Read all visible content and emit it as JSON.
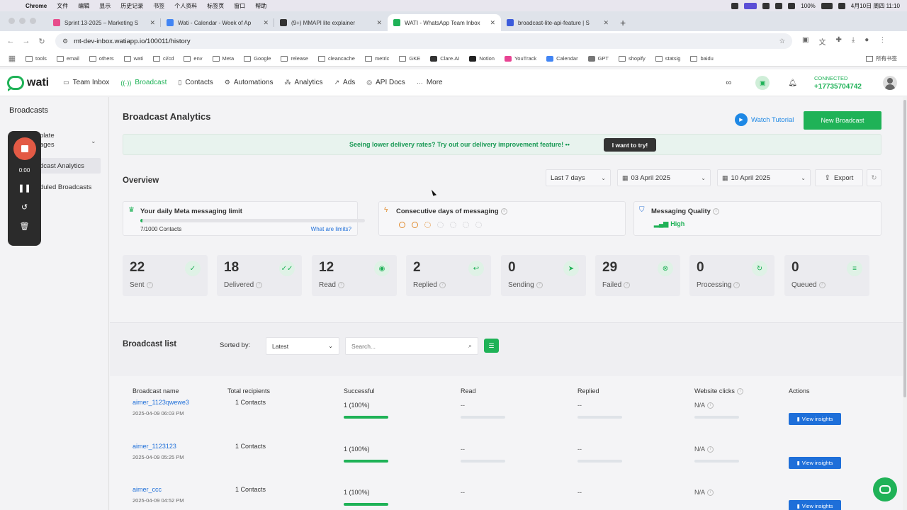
{
  "macbar": {
    "app": "Chrome",
    "menus": [
      "文件",
      "编辑",
      "显示",
      "历史记录",
      "书签",
      "个人资料",
      "标签页",
      "窗口",
      "帮助"
    ],
    "battery": "100%",
    "datetime": "4月10日 周四 11:10"
  },
  "tabs": [
    {
      "title": "Sprint 13-2025 – Marketing S",
      "color": "#e74c8b",
      "active": false
    },
    {
      "title": "Wati - Calendar - Week of Ap",
      "color": "#4285f4",
      "active": false
    },
    {
      "title": "(9+) MMAPI lite explainer",
      "color": "#333333",
      "active": false
    },
    {
      "title": "WATI - WhatsApp Team Inbox",
      "color": "#1fb257",
      "active": true
    },
    {
      "title": "broadcast-lite-api-feature | S",
      "color": "#3b5bdb",
      "active": false
    }
  ],
  "address": {
    "url": "mt-dev-inbox.watiapp.io/100011/history"
  },
  "bookmarks": [
    "tools",
    "email",
    "others",
    "wati",
    "ci/cd",
    "env",
    "Meta",
    "Google",
    "release",
    "cleancache",
    "metric",
    "GKE",
    "Clare.AI",
    "Notion",
    "YouTrack",
    "Calendar",
    "GPT",
    "shopify",
    "statsig",
    "baidu"
  ],
  "bookmarks_right": "所有书签",
  "topnav": {
    "logo": "wati",
    "items": [
      {
        "label": "Team Inbox",
        "icon": "▭",
        "active": false
      },
      {
        "label": "Broadcast",
        "icon": "((·))",
        "active": true
      },
      {
        "label": "Contacts",
        "icon": "▯",
        "active": false
      },
      {
        "label": "Automations",
        "icon": "⚙",
        "active": false
      },
      {
        "label": "Analytics",
        "icon": "⁂",
        "active": false
      },
      {
        "label": "Ads",
        "icon": "↗",
        "active": false
      },
      {
        "label": "API Docs",
        "icon": "◎",
        "active": false
      },
      {
        "label": "More",
        "icon": "···",
        "active": false
      }
    ],
    "connected_label": "CONNECTED",
    "phone": "+17735704742"
  },
  "sidebar": {
    "title": "Broadcasts",
    "item1_line1": "plate",
    "item1_line2": "ages",
    "active_item": "dcast Analytics",
    "item3": "duled Broadcasts"
  },
  "recorder": {
    "time": "0:00"
  },
  "main": {
    "title": "Broadcast Analytics",
    "watch_tutorial": "Watch Tutorial",
    "new_broadcast": "New Broadcast",
    "banner_text": "Seeing lower delivery rates? Try out our delivery improvement feature! ••",
    "banner_button": "I want to try!",
    "overview": "Overview",
    "range": "Last 7 days",
    "date_from": "03 April 2025",
    "date_to": "10 April 2025",
    "export": "Export"
  },
  "cards": {
    "limit_title": "Your daily Meta messaging limit",
    "limit_used": "7/1000 Contacts",
    "limit_fraction": 0.007,
    "limit_link": "What are limits?",
    "consecutive_title": "Consecutive days of messaging",
    "consecutive_dots": 7,
    "consecutive_filled": 2,
    "quality_title": "Messaging Quality",
    "quality_value": "High"
  },
  "stats": [
    {
      "value": "22",
      "label": "Sent",
      "icon": "✓"
    },
    {
      "value": "18",
      "label": "Delivered",
      "icon": "✓✓"
    },
    {
      "value": "12",
      "label": "Read",
      "icon": "◉"
    },
    {
      "value": "2",
      "label": "Replied",
      "icon": "↩"
    },
    {
      "value": "0",
      "label": "Sending",
      "icon": "➤"
    },
    {
      "value": "29",
      "label": "Failed",
      "icon": "⊗"
    },
    {
      "value": "0",
      "label": "Processing",
      "icon": "↻"
    },
    {
      "value": "0",
      "label": "Queued",
      "icon": "≡"
    }
  ],
  "list": {
    "title": "Broadcast list",
    "sorted_by": "Sorted by:",
    "sort_value": "Latest",
    "search_placeholder": "Search...",
    "columns": [
      "Broadcast name",
      "Total recipients",
      "Successful",
      "Read",
      "Replied",
      "Website clicks",
      "Actions"
    ],
    "rows": [
      {
        "name": "aimer_1123qwewe3",
        "date": "2025-04-09 06:03 PM",
        "recipients": "1 Contacts",
        "successful": "1 (100%)",
        "success_fraction": 1.0,
        "read": "--",
        "replied": "--",
        "clicks": "N/A",
        "action": "View insights"
      },
      {
        "name": "aimer_1123123",
        "date": "2025-04-09 05:25 PM",
        "recipients": "1 Contacts",
        "successful": "1 (100%)",
        "success_fraction": 1.0,
        "read": "--",
        "replied": "--",
        "clicks": "N/A",
        "action": "View insights"
      },
      {
        "name": "aimer_ccc",
        "date": "2025-04-09 04:52 PM",
        "recipients": "1 Contacts",
        "successful": "1 (100%)",
        "success_fraction": 1.0,
        "read": "--",
        "replied": "--",
        "clicks": "N/A",
        "action": "View insights"
      }
    ]
  }
}
